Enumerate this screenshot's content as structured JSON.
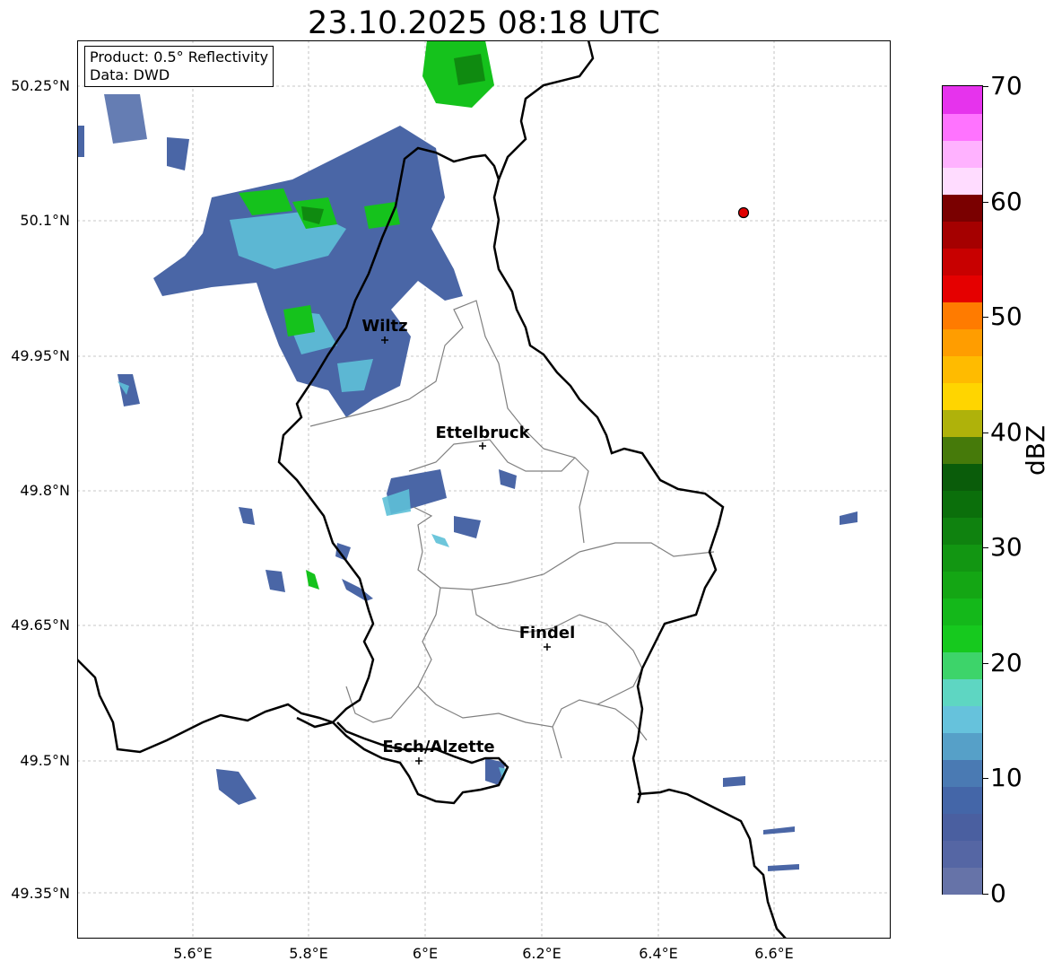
{
  "title": "23.10.2025 08:18 UTC",
  "info": {
    "product_line": "Product: 0.5° Reflectivity",
    "data_line": "Data: DWD"
  },
  "axes": {
    "y_ticks": [
      "50.25°N",
      "50.1°N",
      "49.95°N",
      "49.8°N",
      "49.65°N",
      "49.5°N",
      "49.35°N"
    ],
    "x_ticks": [
      "5.6°E",
      "5.8°E",
      "6°E",
      "6.2°E",
      "6.4°E",
      "6.6°E"
    ],
    "lon_range": [
      5.4,
      6.8
    ],
    "lat_range": [
      49.3,
      50.3
    ]
  },
  "cities": [
    {
      "name": "Wiltz"
    },
    {
      "name": "Ettelbruck"
    },
    {
      "name": "Findel"
    },
    {
      "name": "Esch/Alzette"
    }
  ],
  "radar_site_color": "#e00000",
  "colorbar": {
    "label": "dBZ",
    "ticks": [
      "0",
      "10",
      "20",
      "30",
      "40",
      "50",
      "60",
      "70"
    ],
    "range": [
      0,
      70
    ],
    "colors": [
      "#6673a8",
      "#5566a4",
      "#4a5fa0",
      "#4466a8",
      "#4a7ab3",
      "#56a0c8",
      "#66c2dc",
      "#5ed6c2",
      "#3dd46a",
      "#16c91e",
      "#14b81a",
      "#14a614",
      "#129612",
      "#0f820f",
      "#0b6f0b",
      "#0a5c0a",
      "#467a0a",
      "#afb20a",
      "#ffd500",
      "#ffbb00",
      "#ff9d00",
      "#ff7b00",
      "#e50000",
      "#c80000",
      "#a50000",
      "#7a0000",
      "#ffdcff",
      "#ffb2ff",
      "#ff73ff",
      "#e633ed"
    ]
  }
}
